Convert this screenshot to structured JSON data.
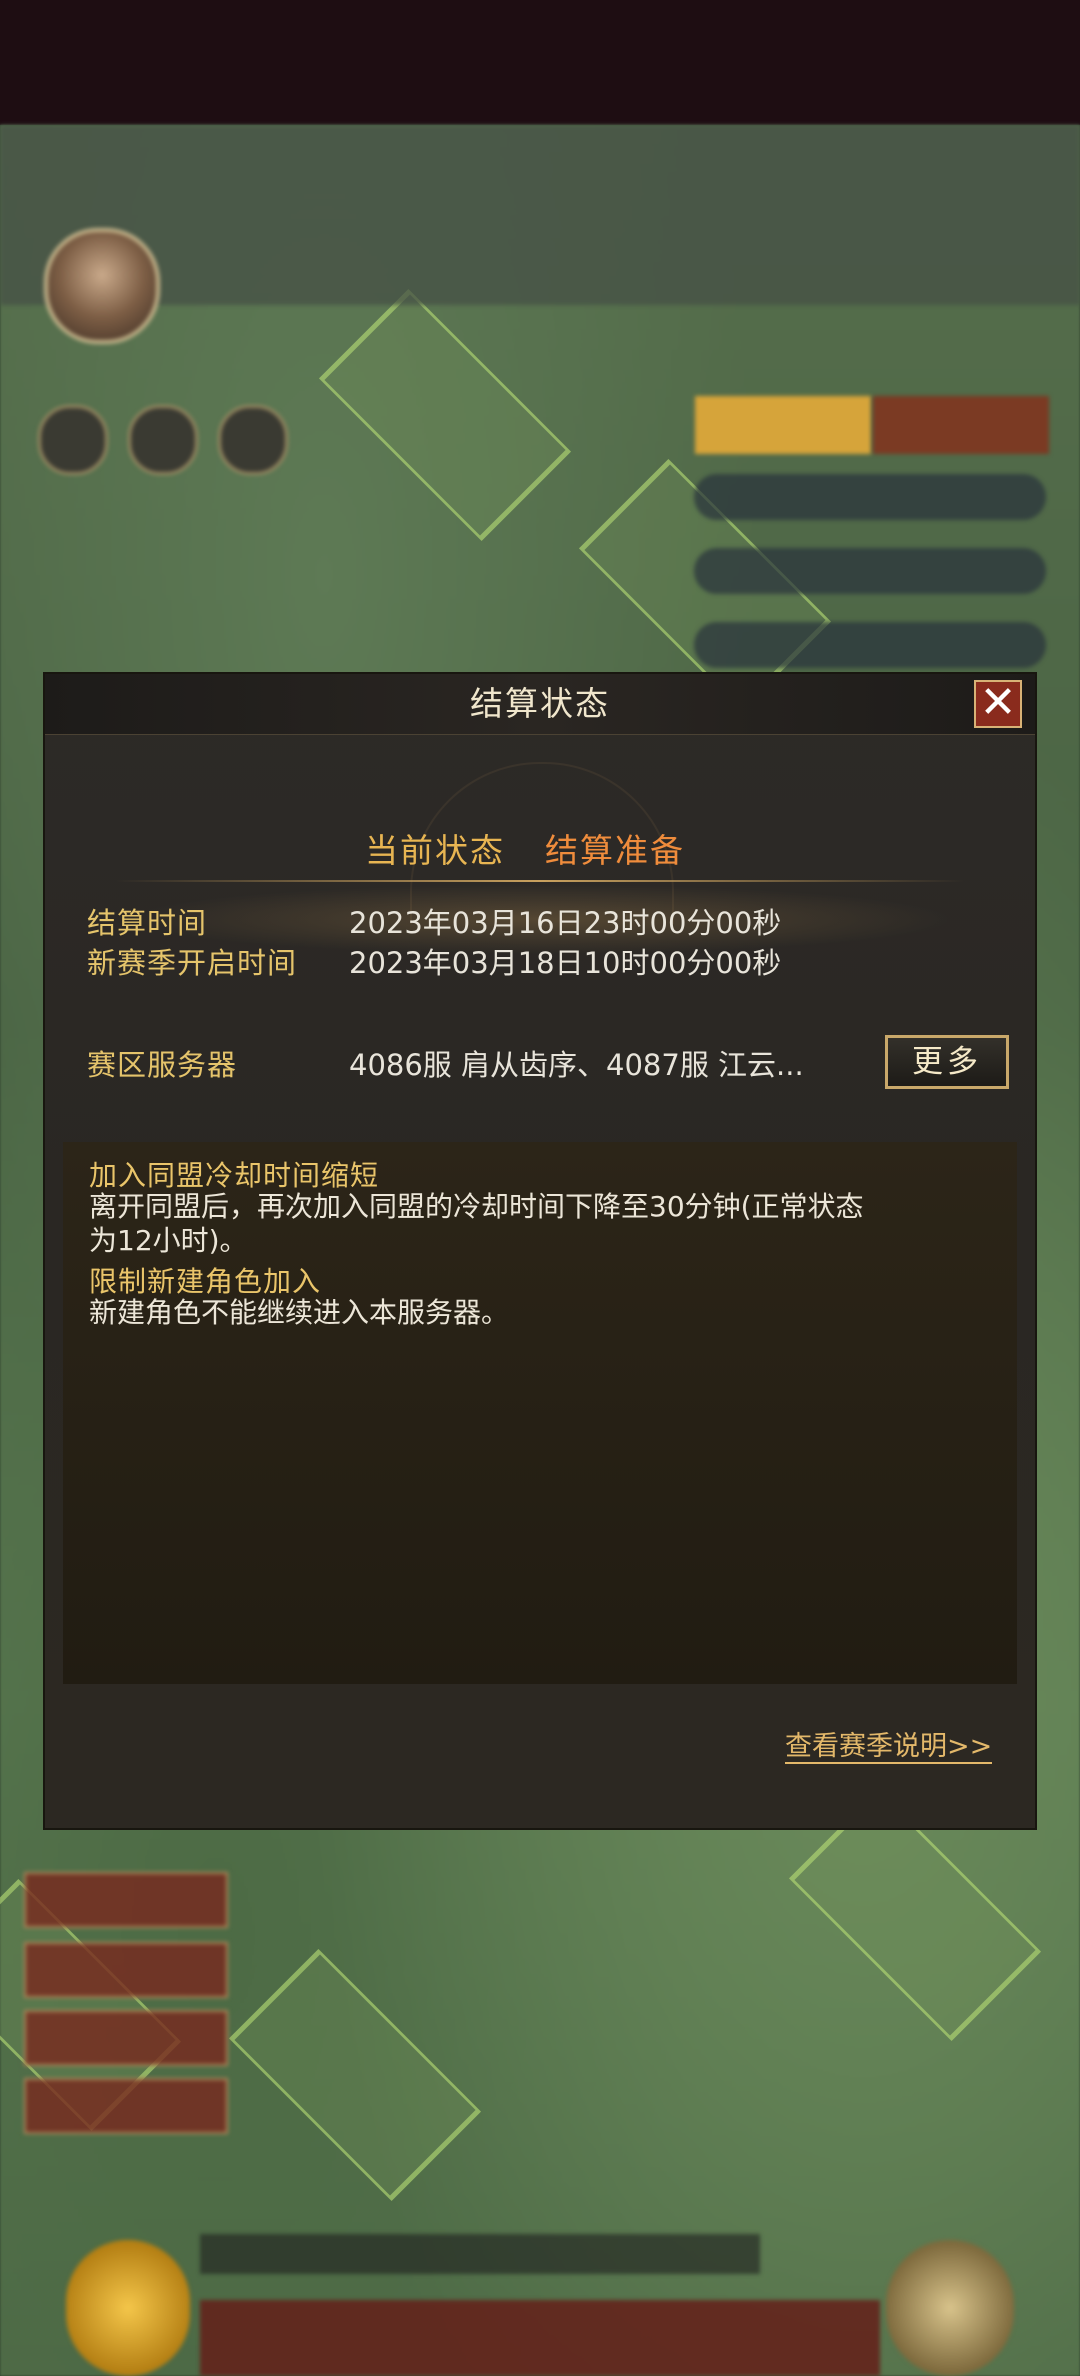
{
  "dialog": {
    "title": "结算状态",
    "close_icon": "close-icon",
    "current_state_label": "当前状态",
    "current_state_value": "结算准备",
    "settle_time_label": "结算时间",
    "settle_time_value": "2023年03月16日23时00分00秒",
    "new_season_label": "新赛季开启时间",
    "new_season_value": "2023年03月18日10时00分00秒",
    "server_label": "赛区服务器",
    "server_value": "4086服 肩从齿序、4087服 江云...",
    "more_button": "更多",
    "notices": [
      {
        "title": "加入同盟冷却时间缩短",
        "body_line1": "离开同盟后，再次加入同盟的冷却时间下降至30分钟(正常状态",
        "body_line2": "为12小时)。"
      },
      {
        "title": "限制新建角色加入",
        "body_line1": "新建角色不能继续进入本服务器。"
      }
    ],
    "season_link": "查看赛季说明>>"
  },
  "colors": {
    "gold_text": "#e5c46b",
    "state_value": "#ef8c3c",
    "state_label": "#e8b552",
    "close_bg": "#8a2b1d"
  }
}
